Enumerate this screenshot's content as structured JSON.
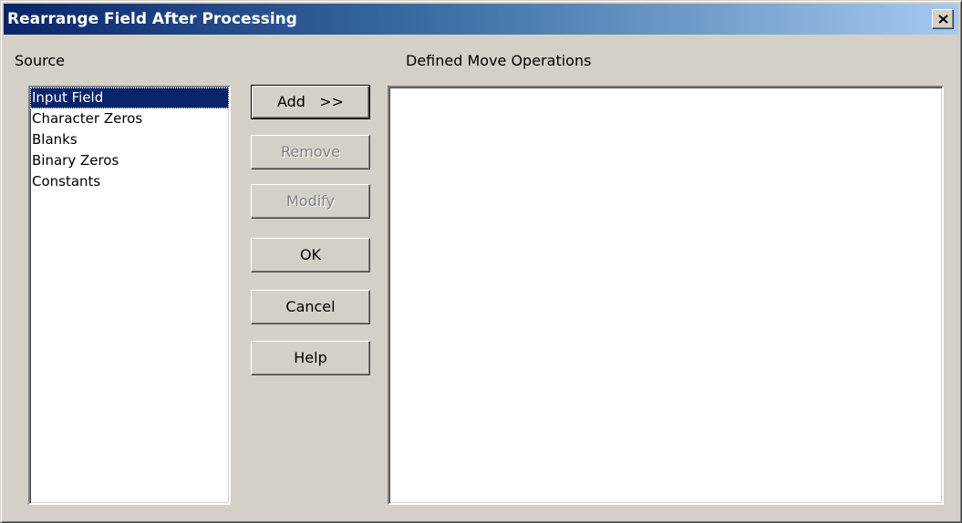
{
  "window": {
    "title": "Rearrange Field After Processing",
    "close_icon": "close-icon"
  },
  "source": {
    "label": "Source",
    "items": [
      {
        "label": "Input Field",
        "selected": true
      },
      {
        "label": "Character Zeros",
        "selected": false
      },
      {
        "label": "Blanks",
        "selected": false
      },
      {
        "label": "Binary Zeros",
        "selected": false
      },
      {
        "label": "Constants",
        "selected": false
      }
    ]
  },
  "operations": {
    "label": "Defined Move Operations",
    "items": []
  },
  "buttons": {
    "add": "Add   >>",
    "remove": "Remove",
    "modify": "Modify",
    "ok": "OK",
    "cancel": "Cancel",
    "help": "Help"
  },
  "colors": {
    "title_bar_start": "#0a246a",
    "title_bar_end": "#a6caf0",
    "selection": "#0a246a",
    "face": "#d4d0c8"
  }
}
